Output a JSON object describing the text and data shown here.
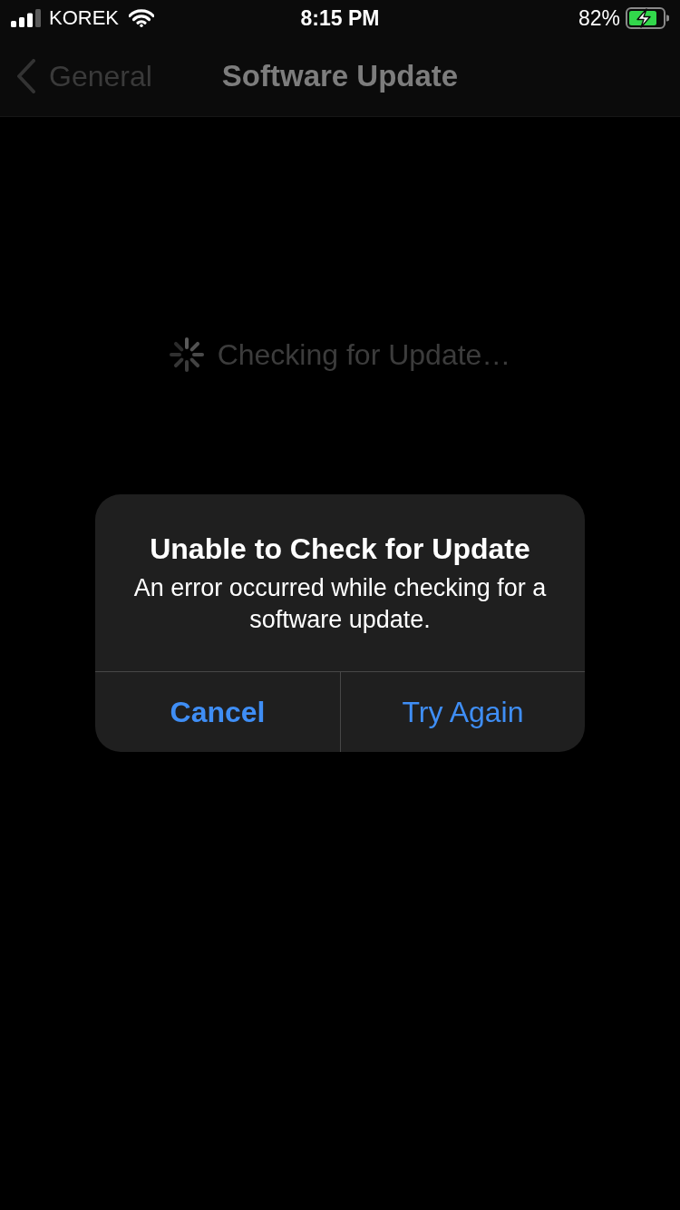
{
  "status_bar": {
    "carrier": "KOREK",
    "time": "8:15 PM",
    "battery_percent": "82%",
    "charging": true
  },
  "nav_bar": {
    "back_label": "General",
    "title": "Software Update"
  },
  "content": {
    "status_text": "Checking for Update…"
  },
  "alert": {
    "title": "Unable to Check for Update",
    "message": "An error occurred while checking for a software update.",
    "buttons": [
      {
        "label": "Cancel",
        "kind": "cancel"
      },
      {
        "label": "Try Again",
        "kind": "default"
      }
    ]
  }
}
